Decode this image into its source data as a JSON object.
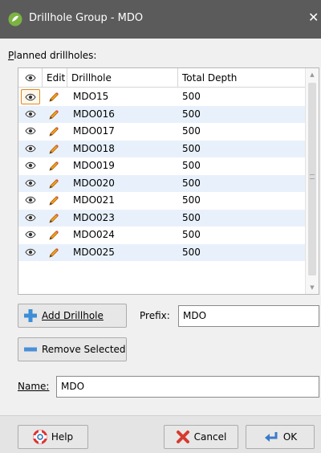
{
  "window": {
    "title": "Drillhole Group - MDO",
    "close_glyph": "✕",
    "icon": "leapfrog-app-icon"
  },
  "planned": {
    "label": "Planned drillholes:",
    "columns": {
      "visible": "eye-icon",
      "edit": "Edit",
      "drillhole": "Drillhole",
      "depth": "Total Depth"
    },
    "rows": [
      {
        "drillhole": "MDO15",
        "depth": "500"
      },
      {
        "drillhole": "MDO016",
        "depth": "500"
      },
      {
        "drillhole": "MDO017",
        "depth": "500"
      },
      {
        "drillhole": "MDO018",
        "depth": "500"
      },
      {
        "drillhole": "MDO019",
        "depth": "500"
      },
      {
        "drillhole": "MDO020",
        "depth": "500"
      },
      {
        "drillhole": "MDO021",
        "depth": "500"
      },
      {
        "drillhole": "MDO023",
        "depth": "500"
      },
      {
        "drillhole": "MDO024",
        "depth": "500"
      },
      {
        "drillhole": "MDO025",
        "depth": "500"
      }
    ]
  },
  "buttons": {
    "add_drillhole": "Add Drillhole",
    "remove_selected": "Remove Selected",
    "help": "Help",
    "cancel": "Cancel",
    "ok": "OK"
  },
  "prefix": {
    "label": "Prefix:",
    "value": "MDO"
  },
  "name": {
    "label": "Name:",
    "value": "MDO"
  },
  "colors": {
    "titlebar": "#5b5b5b",
    "row_alt": "#e8f1fb",
    "selected_border": "#e08a22",
    "add_icon": "#3c8ed6",
    "remove_icon": "#4a90d9"
  }
}
